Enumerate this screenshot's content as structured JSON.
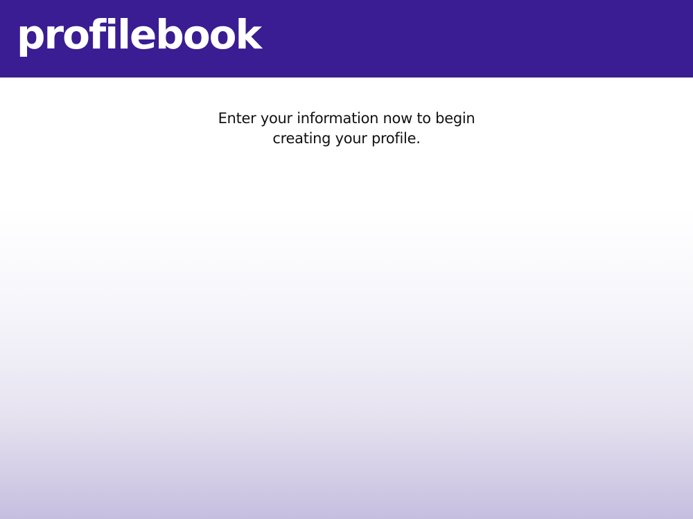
{
  "header": {
    "logo_text": "profilebook",
    "background_color": "#3a1c93"
  },
  "main": {
    "intro_line_1": "Enter your information now to begin",
    "intro_line_2": "creating your profile."
  },
  "colors": {
    "gradient_bottom": "#c6bedf",
    "text": "#111111"
  }
}
